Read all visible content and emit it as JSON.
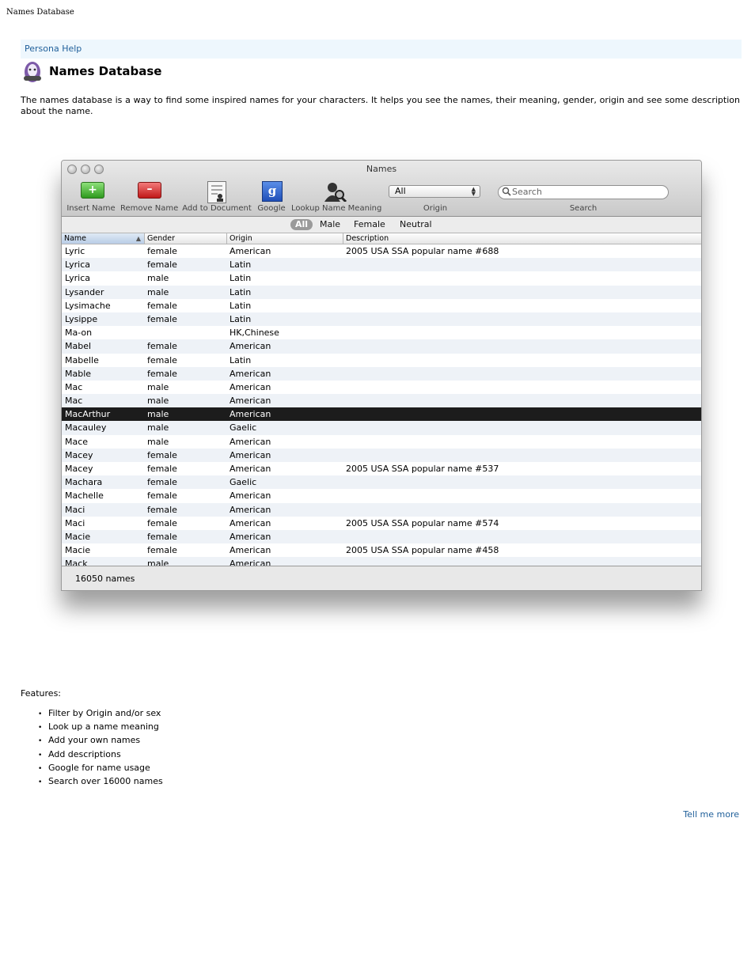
{
  "page_header": "Names Database",
  "help_link": "Persona Help",
  "title": "Names Database",
  "intro": "The names database is a way to find some inspired names for your characters. It helps you see the names, their meaning, gender, origin and see some description about the name.",
  "window": {
    "title": "Names",
    "toolbar": {
      "insert": "Insert Name",
      "remove": "Remove Name",
      "add": "Add to Document",
      "google": "Google",
      "google_glyph": "g",
      "lookup": "Lookup Name Meaning",
      "origin_label": "Origin",
      "origin_value": "All",
      "search_label": "Search",
      "search_placeholder": "Search"
    },
    "filters": [
      "All",
      "Male",
      "Female",
      "Neutral"
    ],
    "columns": [
      "Name",
      "Gender",
      "Origin",
      "Description"
    ],
    "rows": [
      [
        "Lyric",
        "female",
        "American",
        "2005 USA SSA popular name #688"
      ],
      [
        "Lyrica",
        "female",
        "Latin",
        ""
      ],
      [
        "Lyrica",
        "male",
        "Latin",
        ""
      ],
      [
        "Lysander",
        "male",
        "Latin",
        ""
      ],
      [
        "Lysimache",
        "female",
        "Latin",
        ""
      ],
      [
        "Lysippe",
        "female",
        "Latin",
        ""
      ],
      [
        "Ma-on",
        "",
        "HK,Chinese",
        ""
      ],
      [
        "Mabel",
        "female",
        "American",
        ""
      ],
      [
        "Mabelle",
        "female",
        "Latin",
        ""
      ],
      [
        "Mable",
        "female",
        "American",
        ""
      ],
      [
        "Mac",
        "male",
        "American",
        ""
      ],
      [
        "Mac",
        "male",
        "American",
        ""
      ],
      [
        "MacArthur",
        "male",
        "American",
        ""
      ],
      [
        "Macauley",
        "male",
        "Gaelic",
        ""
      ],
      [
        "Mace",
        "male",
        "American",
        ""
      ],
      [
        "Macey",
        "female",
        "American",
        ""
      ],
      [
        "Macey",
        "female",
        "American",
        "2005 USA SSA popular name #537"
      ],
      [
        "Machara",
        "female",
        "Gaelic",
        ""
      ],
      [
        "Machelle",
        "female",
        "American",
        ""
      ],
      [
        "Maci",
        "female",
        "American",
        ""
      ],
      [
        "Maci",
        "female",
        "American",
        "2005 USA SSA popular name #574"
      ],
      [
        "Macie",
        "female",
        "American",
        ""
      ],
      [
        "Macie",
        "female",
        "American",
        "2005 USA SSA popular name #458"
      ],
      [
        "Mack",
        "male",
        "American",
        ""
      ]
    ],
    "selected_row": 12,
    "status": "16050 names"
  },
  "features_heading": "Features:",
  "features": [
    "Filter by Origin and/or sex",
    "Look up a name meaning",
    "Add your own names",
    "Add descriptions",
    "Google for name usage",
    "Search over 16000 names"
  ],
  "more_link": "Tell me more"
}
